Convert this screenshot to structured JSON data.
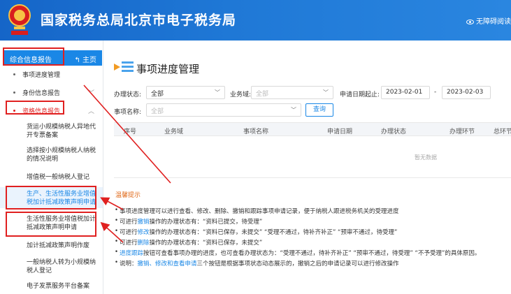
{
  "header": {
    "brand": "国家税务总局北京市电子税务局",
    "accessibility": "无障碍阅读"
  },
  "sidebar": {
    "section_title": "综合信息报告",
    "home_label": "主页",
    "home_icon": "return-arrow-icon",
    "items": [
      {
        "label": "事项进度管理"
      },
      {
        "label": "身份信息报告"
      },
      {
        "label": "资格信息报告"
      }
    ],
    "sub_items": [
      {
        "label": "货运小规模纳税人异地代开专票备案"
      },
      {
        "label": "选择按小规模纳税人纳税的情况说明"
      },
      {
        "label": "增值税一般纳税人登记"
      },
      {
        "label": "生产、生活性服务业增值税加计抵减政策声明申请"
      },
      {
        "label": "生活性服务业增值税加计抵减政策声明申请"
      },
      {
        "label": "加计抵减政策声明作废"
      },
      {
        "label": "一般纳税人转为小规模纳税人登记"
      },
      {
        "label": "电子发票服务平台备案"
      }
    ]
  },
  "main": {
    "title": "事项进度管理",
    "filters": {
      "status_label": "办理状态:",
      "status_value": "全部",
      "domain_label": "业务域:",
      "domain_placeholder": "全部",
      "date_label": "申请日期起止:",
      "date_start": "2023-02-01",
      "date_sep": "-",
      "date_end": "2023-02-03",
      "name_label": "事项名称:",
      "name_placeholder": "全部",
      "query_button": "查询"
    },
    "table": {
      "columns": [
        "序号",
        "业务域",
        "事项名称",
        "申请日期",
        "办理状态",
        "办理环节",
        "总环节"
      ],
      "empty_text": "暂无数据"
    },
    "tips": {
      "title": "温馨提示",
      "lines": [
        {
          "pre": "事项进度管理可以进行查看、修改、删除、撤销和跟踪事项申请记录，便于纳税人跟进税务机关的受理进度",
          "link": "",
          "post": ""
        },
        {
          "pre": "可进行",
          "link": "撤销",
          "post": "操作的办理状态有：“资料已提交，待受理”"
        },
        {
          "pre": "可进行",
          "link": "修改",
          "post": "操作的办理状态有：“资料已保存，未提交” “受理不通过，待补齐补正” “预审不通过，待受理”"
        },
        {
          "pre": "可进行",
          "link": "删除",
          "post": "操作的办理状态有：“资料已保存，未提交”"
        },
        {
          "pre": "",
          "link": "进度跟踪",
          "post": "按钮可查看事项办理的进度，也可查看办理状态为：“受理不通过，待补齐补正” “预审不通过，待受理” “不予受理”的具体原因。"
        },
        {
          "pre": "说明：",
          "link": "撤销、修改和查看申请",
          "post": "三个按钮是根据事项状态动态展示的，撤销之后的申请记录可以进行修改操作"
        }
      ]
    }
  },
  "colors": {
    "header_blue": "#1f78d6",
    "accent_blue": "#1a87e6",
    "annotation_red": "#e02020",
    "tip_orange": "#e06a1a"
  }
}
